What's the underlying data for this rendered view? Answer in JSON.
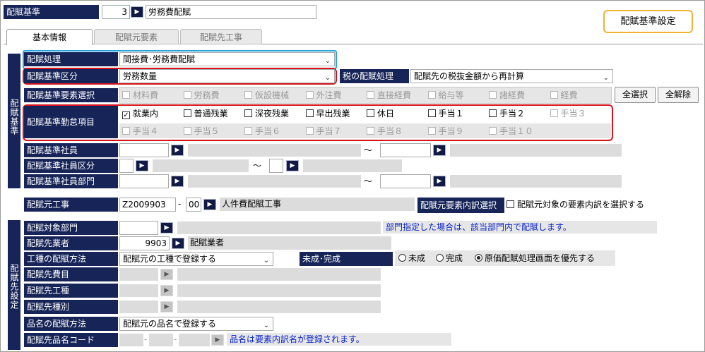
{
  "header": {
    "title_label": "配賦基準",
    "code_value": "3",
    "name_value": "労務費配賦",
    "screen_title": "配賦基準設定"
  },
  "tabs": [
    "基本情報",
    "配賦元要素",
    "配賦先工事"
  ],
  "sections": {
    "haifu_kijun": "配賦基準",
    "haifu_saki": "配賦先設定"
  },
  "method": {
    "label": "配賦処理",
    "value": "間接費･労務費配賦"
  },
  "kubun": {
    "label": "配賦基準区分",
    "value": "労務数量",
    "tax_label": "税の配賦処理",
    "tax_value": "配賦先の税抜金額から再計算"
  },
  "elements": {
    "label": "配賦基準要素選択",
    "items": [
      "材料費",
      "労務費",
      "仮設機械",
      "外注費",
      "直接経費",
      "給与等",
      "諸経費",
      "経費"
    ],
    "select_all": "全選択",
    "clear_all": "全解除"
  },
  "attendance": {
    "label": "配賦基準勤怠項目",
    "row1": [
      {
        "label": "就業内",
        "checked": true,
        "enabled": true
      },
      {
        "label": "普通残業",
        "checked": false,
        "enabled": true
      },
      {
        "label": "深夜残業",
        "checked": false,
        "enabled": true
      },
      {
        "label": "早出残業",
        "checked": false,
        "enabled": true
      },
      {
        "label": "休日",
        "checked": false,
        "enabled": true
      },
      {
        "label": "手当１",
        "checked": false,
        "enabled": true
      },
      {
        "label": "手当２",
        "checked": false,
        "enabled": true
      },
      {
        "label": "手当３",
        "checked": false,
        "enabled": false
      }
    ],
    "row2": [
      {
        "label": "手当４",
        "checked": false,
        "enabled": false
      },
      {
        "label": "手当５",
        "checked": false,
        "enabled": false
      },
      {
        "label": "手当６",
        "checked": false,
        "enabled": false
      },
      {
        "label": "手当７",
        "checked": false,
        "enabled": false
      },
      {
        "label": "手当８",
        "checked": false,
        "enabled": false
      },
      {
        "label": "手当９",
        "checked": false,
        "enabled": false
      },
      {
        "label": "手当１０",
        "checked": false,
        "enabled": false
      }
    ]
  },
  "employee": {
    "label": "配賦基準社員",
    "tilde": "～"
  },
  "employee_kubun": {
    "label": "配賦基準社員区分",
    "tilde": "～"
  },
  "employee_dept": {
    "label": "配賦基準社員部門",
    "tilde": "～"
  },
  "source_work": {
    "label": "配賦元工事",
    "code": "Z2009903",
    "branch": "00",
    "dash": "-",
    "name": "人件費配賦工事",
    "detail_label": "配賦元要素内訳選択",
    "detail_check": "配賦元対象の要素内訳を選択する"
  },
  "target": {
    "dept_label": "配賦対象部門",
    "dept_note": "部門指定した場合は、該当部門内で配賦します。",
    "saki_label": "配賦先業者",
    "saki_code": "9903",
    "saki_name": "配賦業者",
    "koushu_label": "工種の配賦方法",
    "koushu_value": "配賦元の工種で登録する",
    "status_label": "未成･完成",
    "status_options": [
      {
        "label": "未成",
        "selected": false
      },
      {
        "label": "完成",
        "selected": false
      },
      {
        "label": "原価配賦処理画面を優先する",
        "selected": true
      }
    ],
    "himoku_label": "配賦先費目",
    "kouhu_label": "配賦先工種",
    "shubetsu_label": "配賦先種別",
    "hinmei_label": "品名の配賦方法",
    "hinmei_value": "配賦元の品名で登録する",
    "hinmei_code_label": "配賦先品名コード",
    "hinmei_note": "品名は要素内訳名が登録されます。"
  }
}
